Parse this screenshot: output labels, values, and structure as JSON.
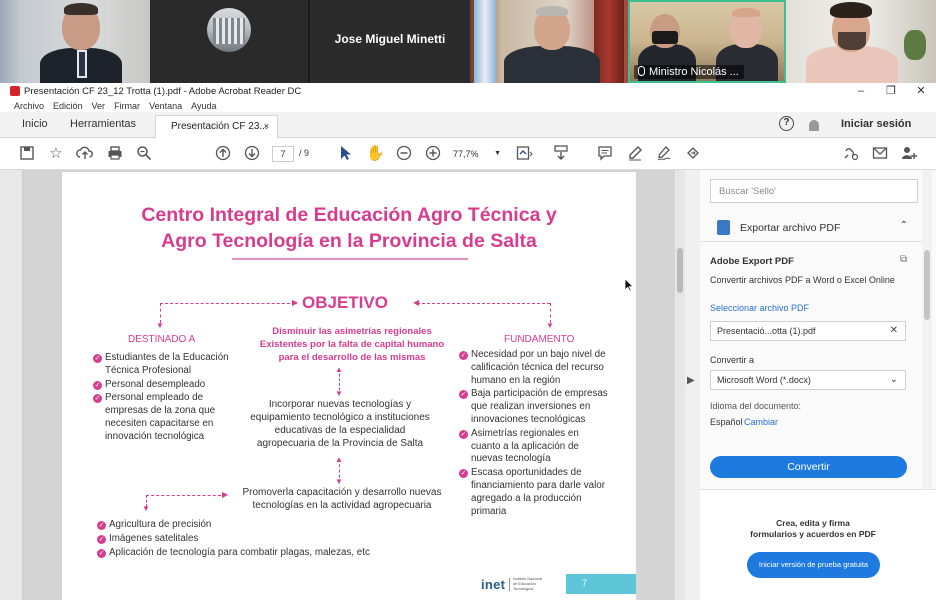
{
  "video": {
    "participant_name": "Jose Miguel Minetti",
    "active_speaker": "Ministro Nicolás ..."
  },
  "window": {
    "title": "Presentación CF 23_12 Trotta (1).pdf - Adobe Acrobat Reader DC",
    "controls": [
      "–",
      "❐",
      "✕"
    ]
  },
  "menu": [
    "Archivo",
    "Edición",
    "Ver",
    "Firmar",
    "Ventana",
    "Ayuda"
  ],
  "tabs": {
    "home": "Inicio",
    "tools": "Herramientas",
    "doc": "Presentación CF 23...",
    "close": "×",
    "help": "?",
    "login": "Iniciar sesión"
  },
  "toolbar": {
    "page_current": "7",
    "page_total": "/ 9",
    "zoom": "77,7%"
  },
  "slide": {
    "title_line1": "Centro Integral de Educación Agro Técnica y",
    "title_line2": "Agro Tecnología en la Provincia de Salta",
    "objetivo": "OBJETIVO",
    "destinado_head": "DESTINADO A",
    "fundamento_head": "FUNDAMENTO",
    "objective_line1": "Disminuir las asimetrías regionales",
    "objective_line2": "Existentes por la falta de capital humano",
    "objective_line3": "para el desarrollo de las mismas",
    "destinado": [
      "Estudiantes de la Educación Técnica Profesional",
      "Personal desempleado",
      "Personal empleado de empresas de la zona que necesiten capacitarse en innovación tecnológica"
    ],
    "incorporar_line1": "Incorporar nuevas tecnologías y",
    "incorporar_line2": "equipamiento tecnológico a instituciones",
    "incorporar_line3": "educativas de la especialidad",
    "incorporar_line4": "agropecuaria de la Provincia de Salta",
    "promover_line1": "Promoverla capacitación y desarrollo nuevas",
    "promover_line2": "tecnologías en la actividad agropecuaria",
    "fundamento": [
      "Necesidad por un bajo nivel de calificación técnica del recurso humano en la región",
      "Baja participación de empresas que realizan inversiones en innovaciones tecnológicas",
      "Asimetrías regionales en cuanto a la aplicación de nuevas tecnología",
      "Escasa oportunidades de financiamiento para darle valor agregado a la producción primaria"
    ],
    "tech": [
      "Agricultura de precisión",
      "Imágenes satelitales",
      "Aplicación de tecnología para combatir plagas, malezas, etc"
    ],
    "footer_logo": "inet",
    "footer_sub": "Instituto Nacional de Educación Tecnológica",
    "page_number": "7"
  },
  "panel": {
    "search_placeholder": "Buscar 'Sello'",
    "export_title": "Exportar archivo PDF",
    "adobe_export": "Adobe Export PDF",
    "adobe_desc": "Convertir archivos PDF a Word o Excel Online",
    "select_file": "Seleccionar archivo PDF",
    "file_name": "Presentació...otta (1).pdf",
    "convert_to": "Convertir a",
    "format": "Microsoft Word (*.docx)",
    "language_label": "Idioma del documento:",
    "language": "Español",
    "change": "Cambiar",
    "convert_btn": "Convertir",
    "promo_line1": "Crea, edita y firma",
    "promo_line2": "formularios y acuerdos en PDF",
    "trial_btn": "Iniciar versión de prueba gratuita"
  }
}
